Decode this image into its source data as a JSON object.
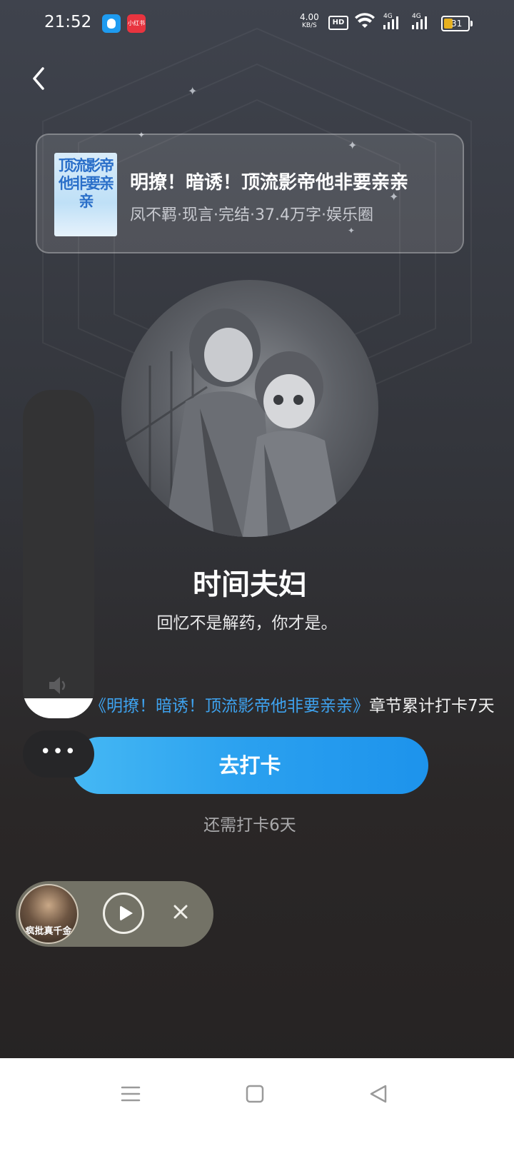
{
  "status_bar": {
    "time": "21:52",
    "app_badge": "小红书",
    "net_speed_value": "4.00",
    "net_speed_unit": "KB/S",
    "hd_label": "HD",
    "network_label": "4G",
    "battery_level": "31"
  },
  "book": {
    "cover_text": "顶流影帝他非要亲亲",
    "title": "明撩！暗诱！顶流影帝他非要亲亲",
    "meta": "凤不羁·现言·完结·37.4万字·娱乐圈"
  },
  "couple": {
    "title": "时间夫妇",
    "quote": "回忆不是解药，你才是。"
  },
  "progress": {
    "book_link": "《明撩！暗诱！顶流影帝他非要亲亲》",
    "text": "章节累计打卡7天"
  },
  "checkin": {
    "button_label": "去打卡",
    "remaining": "还需打卡6天"
  },
  "volume": {
    "level": 0.06
  },
  "more_menu": {
    "label": "•••"
  },
  "mini_player": {
    "thumb_text": "疯批真千金"
  },
  "colors": {
    "accent": "#2aa0ef",
    "link": "#3ea2ee",
    "battery": "#e6b01f"
  }
}
